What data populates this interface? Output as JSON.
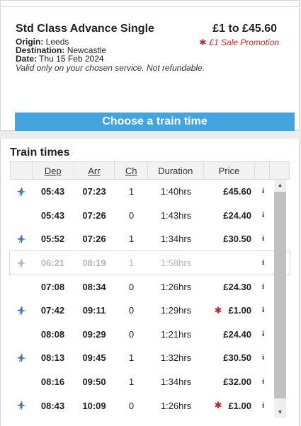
{
  "ticket": {
    "title": "Std Class Advance Single",
    "price_range": "£1 to £45.60",
    "promo": "£1 Sale Promotion",
    "origin_label": "Origin:",
    "origin": "Leeds",
    "destination_label": "Destination:",
    "destination": "Newcastle",
    "date_label": "Date:",
    "date": "Thu 15 Feb 2024",
    "validity": "Valid only on your chosen service. Not refundable.",
    "choose_button": "Choose a train time"
  },
  "times": {
    "heading": "Train times",
    "columns": {
      "dep": "Dep",
      "arr": "Arr",
      "ch": "Ch",
      "duration": "Duration",
      "price": "Price"
    },
    "rows": [
      {
        "dep": "05:43",
        "arr": "07:23",
        "ch": "1",
        "duration": "1:40hrs",
        "price": "£45.60",
        "sale": false,
        "brand_icon": true,
        "dimmed": false,
        "selected": false
      },
      {
        "dep": "05:43",
        "arr": "07:26",
        "ch": "0",
        "duration": "1:43hrs",
        "price": "£24.40",
        "sale": false,
        "brand_icon": false,
        "dimmed": false,
        "selected": false
      },
      {
        "dep": "05:52",
        "arr": "07:26",
        "ch": "1",
        "duration": "1:34hrs",
        "price": "£30.50",
        "sale": false,
        "brand_icon": true,
        "dimmed": false,
        "selected": false
      },
      {
        "dep": "06:21",
        "arr": "08:19",
        "ch": "1",
        "duration": "1:58hrs",
        "price": "",
        "sale": false,
        "brand_icon": true,
        "dimmed": true,
        "selected": true
      },
      {
        "dep": "07:08",
        "arr": "08:34",
        "ch": "0",
        "duration": "1:26hrs",
        "price": "£24.30",
        "sale": false,
        "brand_icon": false,
        "dimmed": false,
        "selected": false
      },
      {
        "dep": "07:42",
        "arr": "09:11",
        "ch": "0",
        "duration": "1:29hrs",
        "price": "£1.00",
        "sale": true,
        "brand_icon": true,
        "dimmed": false,
        "selected": false
      },
      {
        "dep": "08:08",
        "arr": "09:29",
        "ch": "0",
        "duration": "1:21hrs",
        "price": "£24.40",
        "sale": false,
        "brand_icon": false,
        "dimmed": false,
        "selected": false
      },
      {
        "dep": "08:13",
        "arr": "09:45",
        "ch": "1",
        "duration": "1:32hrs",
        "price": "£30.50",
        "sale": false,
        "brand_icon": true,
        "dimmed": false,
        "selected": false
      },
      {
        "dep": "08:16",
        "arr": "09:50",
        "ch": "1",
        "duration": "1:34hrs",
        "price": "£32.00",
        "sale": false,
        "brand_icon": false,
        "dimmed": false,
        "selected": false
      },
      {
        "dep": "08:43",
        "arr": "10:09",
        "ch": "0",
        "duration": "1:26hrs",
        "price": "£1.00",
        "sale": true,
        "brand_icon": true,
        "dimmed": false,
        "selected": false
      }
    ],
    "info_glyph": "i",
    "sale_glyph": "*",
    "icons": {
      "brand": "operator-star-icon",
      "info": "info-icon",
      "sale": "sale-star-icon"
    }
  },
  "colors": {
    "button_blue": "#44a4e0",
    "promo_red": "#c0272d",
    "brand_blue": "#3a78c9",
    "brand_red": "#d93a3a"
  }
}
